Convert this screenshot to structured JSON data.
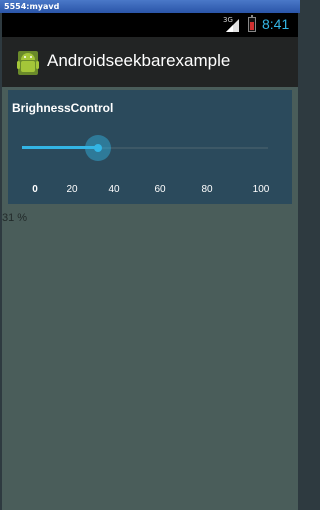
{
  "window": {
    "title": "5554:myavd"
  },
  "status_bar": {
    "network": "3G",
    "time": "8:41"
  },
  "action_bar": {
    "title": "Androidseekbarexample",
    "icon": "android-icon"
  },
  "brightness": {
    "title": "BrighnessControl",
    "value_percent": 31,
    "ticks": [
      "0",
      "20",
      "40",
      "60",
      "80",
      "100"
    ],
    "readout": "31 %"
  },
  "colors": {
    "accent": "#33b5e5",
    "card": "#2b4a5c",
    "background": "#4a5d5a"
  }
}
